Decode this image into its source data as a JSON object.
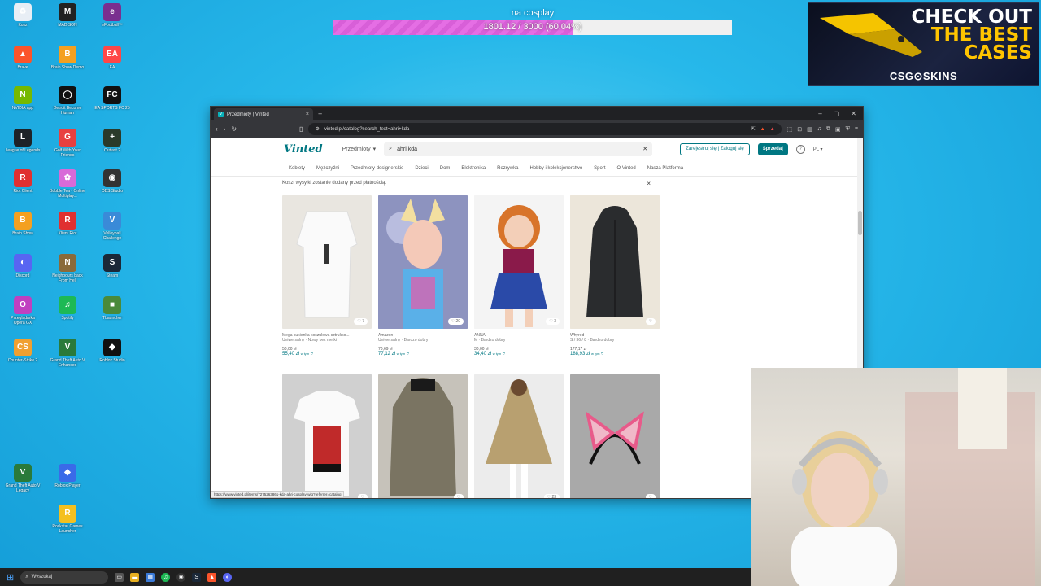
{
  "desktop": {
    "icons": [
      {
        "label": "Kosz",
        "glyph": "♻",
        "color": "#e8eef5"
      },
      {
        "label": "MADISON",
        "glyph": "M",
        "color": "#222222"
      },
      {
        "label": "eFootball™",
        "glyph": "e",
        "color": "#7a2f8f"
      },
      {
        "label": "Brave",
        "glyph": "▲",
        "color": "#fb542b"
      },
      {
        "label": "Brain Show Demo",
        "glyph": "B",
        "color": "#f4a020"
      },
      {
        "label": "EA",
        "glyph": "EA",
        "color": "#ff4747"
      },
      {
        "label": "NVIDIA app",
        "glyph": "N",
        "color": "#76b900"
      },
      {
        "label": "Detroit Become Human",
        "glyph": "◯",
        "color": "#111111"
      },
      {
        "label": "EA SPORTS FC 25",
        "glyph": "FC",
        "color": "#111111"
      },
      {
        "label": "League of Legends",
        "glyph": "L",
        "color": "#1e2328"
      },
      {
        "label": "Golf With Your Friends",
        "glyph": "G",
        "color": "#e84040"
      },
      {
        "label": "Outlast 2",
        "glyph": "+",
        "color": "#2a3a2a"
      },
      {
        "label": "Riot Client",
        "glyph": "R",
        "color": "#e03030"
      },
      {
        "label": "Bubble Tea - Online Multiplay...",
        "glyph": "✿",
        "color": "#d86ad8"
      },
      {
        "label": "OBS Studio",
        "glyph": "◉",
        "color": "#333333"
      },
      {
        "label": "Brain Show",
        "glyph": "B",
        "color": "#f4a020"
      },
      {
        "label": "Klient Riot",
        "glyph": "R",
        "color": "#e03030"
      },
      {
        "label": "Volleyball Challenge",
        "glyph": "V",
        "color": "#3a8ad8"
      },
      {
        "label": "Discord",
        "glyph": "◐",
        "color": "#5865f2"
      },
      {
        "label": "Neighbours back From Hell",
        "glyph": "N",
        "color": "#8a6a3a"
      },
      {
        "label": "Steam",
        "glyph": "S",
        "color": "#1b2838"
      },
      {
        "label": "Przeglądarka Opera GX",
        "glyph": "O",
        "color": "#c040c0"
      },
      {
        "label": "Spotify",
        "glyph": "♫",
        "color": "#1db954"
      },
      {
        "label": "TLauncher",
        "glyph": "■",
        "color": "#4a8a3a"
      },
      {
        "label": "Counter-Strike 2",
        "glyph": "CS",
        "color": "#f0a030"
      },
      {
        "label": "Grand Theft Auto V Enhanced",
        "glyph": "V",
        "color": "#2a7a3a"
      },
      {
        "label": "Roblox Studio",
        "glyph": "◆",
        "color": "#111111"
      },
      {
        "label": "Grand Theft Auto V Legacy",
        "glyph": "V",
        "color": "#2a7a3a"
      },
      {
        "label": "Roblox Player",
        "glyph": "◆",
        "color": "#3a6ae8"
      },
      {
        "label": "Rockstar Games Launcher",
        "glyph": "R",
        "color": "#f4c020"
      }
    ]
  },
  "goal": {
    "title": "na cosplay",
    "text": "1801.12 / 3000 (60.04%)",
    "fraction": 0.6004
  },
  "ad": {
    "line1": "CHECK OUT",
    "line2": "THE BEST",
    "line3": "CASES",
    "brand": "CSG⊙SKINS"
  },
  "browser": {
    "tab_title": "Przedmioty | Vinted",
    "tab_close": "×",
    "new_tab": "+",
    "url": "vinted.pl/catalog?search_text=ahri+kda",
    "status_url": "https://www.vinted.pl/items/7275263861-kda-ahri-cosplay-wig?referrer=catalog"
  },
  "vinted": {
    "logo": "Vinted",
    "search_category": "Przedmioty",
    "search_query": "ahri kda",
    "register_button": "Zarejestruj się | Zaloguj się",
    "sell_button": "Sprzedaj",
    "help": "?",
    "language": "PL",
    "nav": [
      "Kobiety",
      "Mężczyźni",
      "Przedmioty designerskie",
      "Dzieci",
      "Dom",
      "Elektronika",
      "Rozrywka",
      "Hobby i kolekcjonerstwo",
      "Sport",
      "O Vinted",
      "Nasza Platforma"
    ],
    "notice": "Koszt wysyłki zostanie dodany przed płatnością.",
    "notice_close": "×",
    "items_row1": [
      {
        "title": "Mega sukienka koszulowa sztrukso...",
        "sub": "Uniwersalny · Nowy bez metki",
        "price": "50,00 zł",
        "total": "55,40 zł",
        "total_suffix": "w tym",
        "likes": "7",
        "bg": "#e9e6e0",
        "img": "dress"
      },
      {
        "title": "Amazon",
        "sub": "Uniwersalny · Bardzo dobry",
        "price": "70,69 zł",
        "total": "77,12 zł",
        "total_suffix": "w tym",
        "likes": "20",
        "bg": "#9aa0c8",
        "img": "cosplay"
      },
      {
        "title": "ANNA",
        "sub": "M · Bardzo dobry",
        "price": "30,00 zł",
        "total": "34,40 zł",
        "total_suffix": "w tym",
        "likes": "3",
        "bg": "#f2f2f2",
        "img": "doll"
      },
      {
        "title": "Whyred",
        "sub": "S / 36 / 8 · Bardzo dobry",
        "price": "177,17 zł",
        "total": "188,93 zł",
        "total_suffix": "w tym",
        "likes": "",
        "bg": "#e8e2d6",
        "img": "coat"
      }
    ],
    "items_row2": [
      {
        "likes": "",
        "bg": "#d8d8d8",
        "img": "tshirt"
      },
      {
        "likes": "",
        "bg": "#c8c4bc",
        "img": "jacket"
      },
      {
        "likes": "23",
        "bg": "#e8e8e8",
        "img": "cape"
      },
      {
        "likes": "",
        "bg": "#a8a8a8",
        "img": "ears"
      }
    ]
  },
  "taskbar": {
    "search": "Wyszukaj"
  }
}
